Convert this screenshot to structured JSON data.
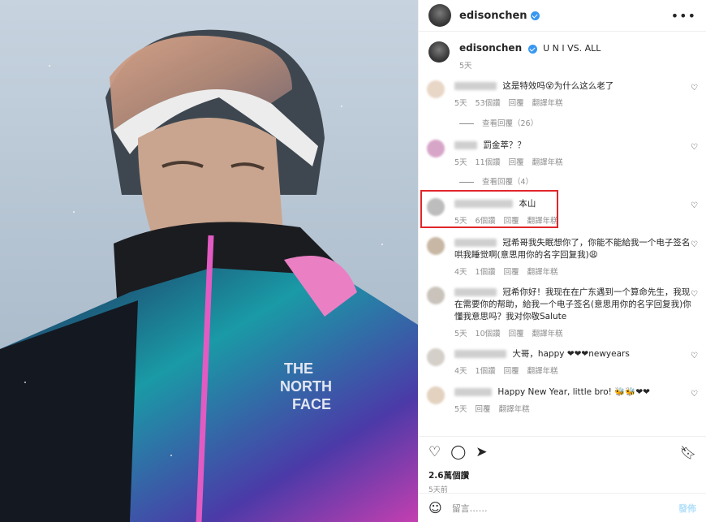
{
  "post": {
    "username": "edisonchen",
    "caption": "U N I VS. ALL",
    "caption_time": "5天",
    "likes": "2.6萬個讚",
    "post_time": "5天前",
    "comment_placeholder": "留言……",
    "post_button": "發佈",
    "more_icon": "more-horizontal-icon"
  },
  "comments": [
    {
      "text": "这是特效吗😵为什么这么老了",
      "time": "5天",
      "likes": "53個讚",
      "reply": "回覆",
      "translate": "翻譯年糕",
      "replies": "查看回覆（26）"
    },
    {
      "text": "罰金萃？？",
      "time": "5天",
      "likes": "11個讚",
      "reply": "回覆",
      "translate": "翻譯年糕",
      "replies": "查看回覆（4）"
    },
    {
      "text": "本山",
      "time": "5天",
      "likes": "6個讚",
      "reply": "回覆",
      "translate": "翻譯年糕"
    },
    {
      "text": "冠希哥我失眠想你了，你能不能給我一个电子签名哄我睡觉啊(意思用你的名字回复我)😩",
      "time": "4天",
      "likes": "1個讚",
      "reply": "回覆",
      "translate": "翻譯年糕"
    },
    {
      "text": "冠希你好！我现在在广东遇到一个算命先生，我现在需要你的帮助，給我一个电子签名(意思用你的名字回复我)你懂我意思吗？我对你敬Salute",
      "time": "5天",
      "likes": "10個讚",
      "reply": "回覆",
      "translate": "翻譯年糕"
    },
    {
      "text": "大哥，happy ❤❤❤newyears",
      "time": "4天",
      "likes": "1個讚",
      "reply": "回覆",
      "translate": "翻譯年糕"
    },
    {
      "text": "Happy New Year, little bro! 🐝🐝❤❤",
      "time": "5天",
      "likes": "",
      "reply": "回覆",
      "translate": "翻譯年糕"
    }
  ],
  "photo": {
    "jacket_text": "THE NORTH FACE"
  },
  "colors": {
    "accent": "#3897f0",
    "highlight": "#e0262b"
  }
}
